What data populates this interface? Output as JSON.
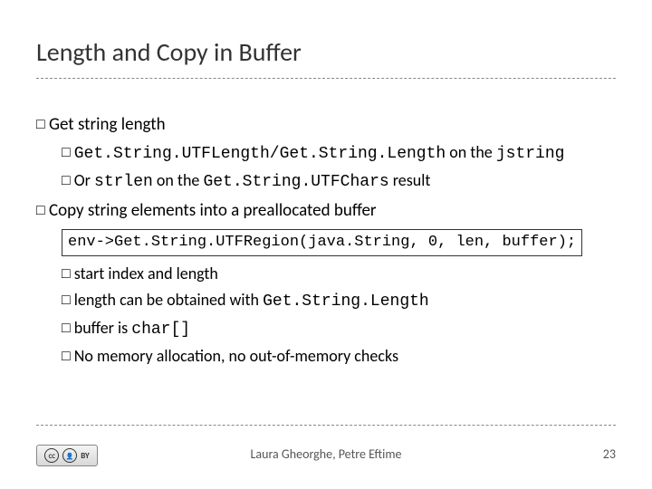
{
  "title": "Length and Copy in Buffer",
  "bullets": {
    "b1_prefix": "Get ",
    "b1_rest": "string length",
    "b1a_code": "Get.String.UTFLength/Get.String.Length",
    "b1a_mid": " on the ",
    "b1a_code2": "jstring",
    "b1b_prefix": "Or ",
    "b1b_code": "strlen",
    "b1b_mid": " on the ",
    "b1b_code2": "Get.String.UTFChars",
    "b1b_suffix": " result",
    "b2_prefix": "Copy ",
    "b2_rest": "string elements into a preallocated buffer",
    "codebox": "env->Get.String.UTFRegion(java.String, 0, len, buffer);",
    "b2a_prefix": "start ",
    "b2a_rest": "index and length",
    "b2b_prefix": "length ",
    "b2b_mid": "can be obtained with ",
    "b2b_code": "Get.String.Length",
    "b2c_prefix": "buffer ",
    "b2c_mid": "is ",
    "b2c_code": "char[]",
    "b2d_prefix": "No ",
    "b2d_rest": "memory allocation, no out-of-memory checks"
  },
  "footer": {
    "authors": "Laura Gheorghe, Petre Eftime",
    "page": "23",
    "cc_text": "CC",
    "by_text": "BY"
  }
}
